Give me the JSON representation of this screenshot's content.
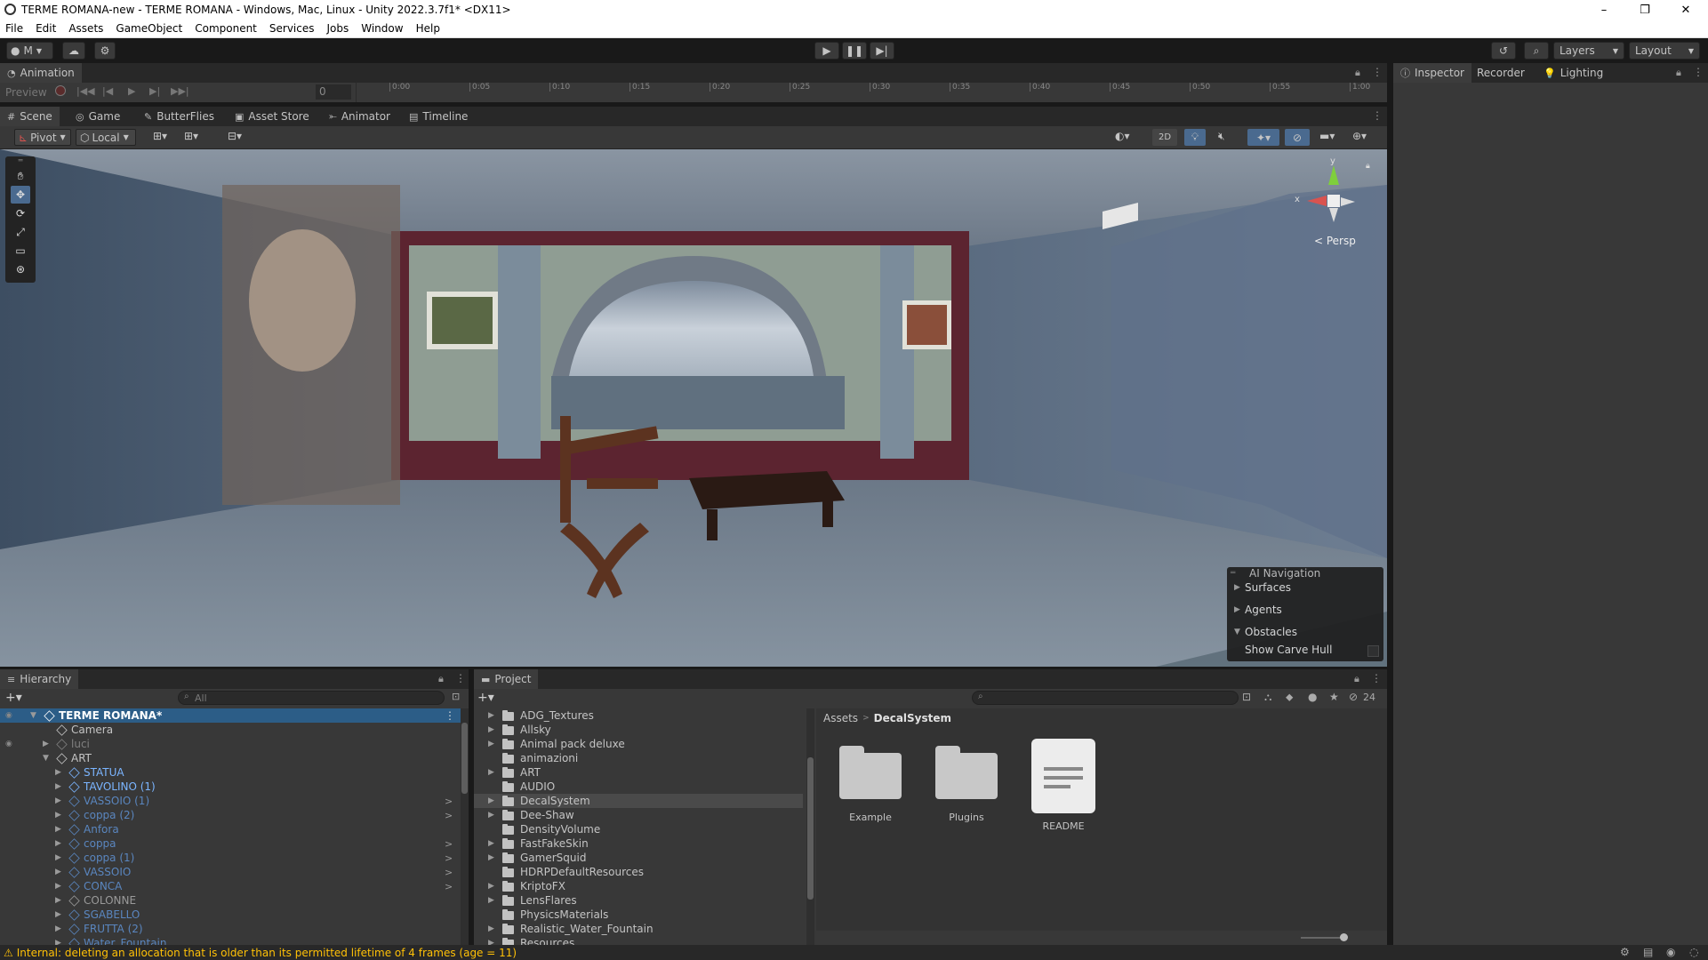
{
  "window": {
    "title": "TERME ROMANA-new - TERME ROMANA - Windows, Mac, Linux - Unity 2022.3.7f1* <DX11>",
    "controls": [
      "–",
      "❐",
      "✕"
    ]
  },
  "menu": [
    "File",
    "Edit",
    "Assets",
    "GameObject",
    "Component",
    "Services",
    "Jobs",
    "Window",
    "Help"
  ],
  "toolbar": {
    "account": "M",
    "layers": "Layers",
    "layout": "Layout"
  },
  "animation": {
    "tab": "Animation",
    "preview": "Preview",
    "frame": "0",
    "ticks": [
      "0:00",
      "0:05",
      "0:10",
      "0:15",
      "0:20",
      "0:25",
      "0:30",
      "0:35",
      "0:40",
      "0:45",
      "0:50",
      "0:55",
      "1:00"
    ]
  },
  "scene_tabs": [
    {
      "label": "Scene",
      "icon": "#"
    },
    {
      "label": "Game",
      "icon": "◎"
    },
    {
      "label": "ButterFlies",
      "icon": "✎"
    },
    {
      "label": "Asset Store",
      "icon": "▣"
    },
    {
      "label": "Animator",
      "icon": "⤜"
    },
    {
      "label": "Timeline",
      "icon": "▤"
    }
  ],
  "scene_toolbar": {
    "pivot": "Pivot",
    "local": "Local",
    "mode_2d": "2D"
  },
  "viewport": {
    "persp": "< Persp",
    "gizmo_x": "x",
    "gizmo_y": "y"
  },
  "ai_navigation": {
    "title": "AI Navigation",
    "items": [
      "Surfaces",
      "Agents",
      "Obstacles"
    ],
    "option": "Show Carve Hull"
  },
  "inspector_tabs": [
    {
      "label": "Inspector",
      "icon": "ⓘ"
    },
    {
      "label": "Recorder",
      "icon": ""
    },
    {
      "label": "Lighting",
      "icon": "💡"
    }
  ],
  "hierarchy": {
    "tab": "Hierarchy",
    "search_placeholder": "All",
    "rows": [
      {
        "label": "TERME ROMANA*",
        "indent": 0,
        "style": "scene"
      },
      {
        "label": "Camera",
        "indent": 1,
        "style": "normal"
      },
      {
        "label": "luci",
        "indent": 1,
        "style": "dim"
      },
      {
        "label": "ART",
        "indent": 1,
        "style": "normal"
      },
      {
        "label": "STATUA",
        "indent": 2,
        "style": "prefab"
      },
      {
        "label": "TAVOLINO (1)",
        "indent": 2,
        "style": "prefab"
      },
      {
        "label": "VASSOIO (1)",
        "indent": 2,
        "style": "prefab-dim"
      },
      {
        "label": "coppa (2)",
        "indent": 2,
        "style": "prefab-dim"
      },
      {
        "label": "Anfora",
        "indent": 2,
        "style": "prefab-dim"
      },
      {
        "label": "coppa",
        "indent": 2,
        "style": "prefab-dim"
      },
      {
        "label": "coppa (1)",
        "indent": 2,
        "style": "prefab-dim"
      },
      {
        "label": "VASSOIO",
        "indent": 2,
        "style": "prefab-dim"
      },
      {
        "label": "CONCA",
        "indent": 2,
        "style": "prefab-dim"
      },
      {
        "label": "COLONNE",
        "indent": 2,
        "style": "normal-dim"
      },
      {
        "label": "SGABELLO",
        "indent": 2,
        "style": "prefab-dim"
      },
      {
        "label": "FRUTTA (2)",
        "indent": 2,
        "style": "prefab-dim"
      },
      {
        "label": "Water_Fountain",
        "indent": 2,
        "style": "prefab-dim"
      }
    ]
  },
  "project": {
    "tab": "Project",
    "count": "24",
    "breadcrumb": [
      "Assets",
      "DecalSystem"
    ],
    "folders": [
      "ADG_Textures",
      "Allsky",
      "Animal pack deluxe",
      "animazioni",
      "ART",
      "AUDIO",
      "DecalSystem",
      "Dee-Shaw",
      "DensityVolume",
      "FastFakeSkin",
      "GamerSquid",
      "HDRPDefaultResources",
      "KriptoFX",
      "LensFlares",
      "PhysicsMaterials",
      "Realistic_Water_Fountain",
      "Resources"
    ],
    "assets": [
      {
        "label": "Example",
        "kind": "folder"
      },
      {
        "label": "Plugins",
        "kind": "folder"
      },
      {
        "label": "README",
        "kind": "document"
      }
    ]
  },
  "status": {
    "message": "Internal: deleting an allocation that is older than its permitted lifetime of 4 frames (age = 11)"
  }
}
